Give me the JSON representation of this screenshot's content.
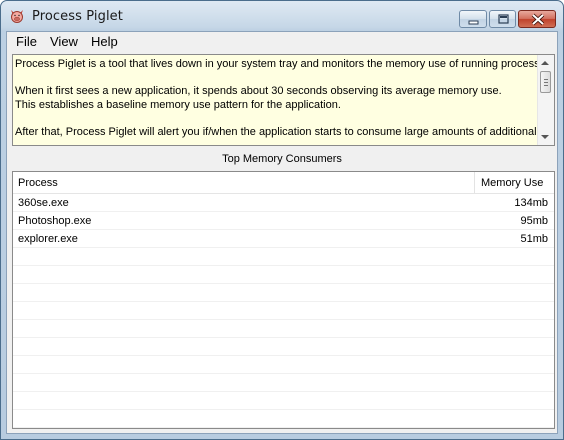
{
  "window": {
    "title": "Process Piglet",
    "icon": "pig-icon",
    "controls": [
      "minimize-icon",
      "maximize-icon",
      "close-icon"
    ]
  },
  "menu": [
    {
      "label": "File"
    },
    {
      "label": "View"
    },
    {
      "label": "Help"
    }
  ],
  "info": {
    "paragraphs": [
      "Process Piglet is a tool that lives down in your system tray and monitors the memory use of running processes.",
      "When it first sees a new application, it spends about 30 seconds observing its average memory use.  This establishes a baseline memory use pattern for the application.",
      "After that, Process Piglet will alert you if/when the application starts to consume large amounts of additional"
    ]
  },
  "consumers": {
    "title": "Top Memory Consumers",
    "columns": [
      "Process",
      "Memory Use"
    ],
    "rows": [
      {
        "process": "360se.exe",
        "memory": "134mb"
      },
      {
        "process": "Photoshop.exe",
        "memory": "95mb"
      },
      {
        "process": "explorer.exe",
        "memory": "51mb"
      }
    ]
  }
}
